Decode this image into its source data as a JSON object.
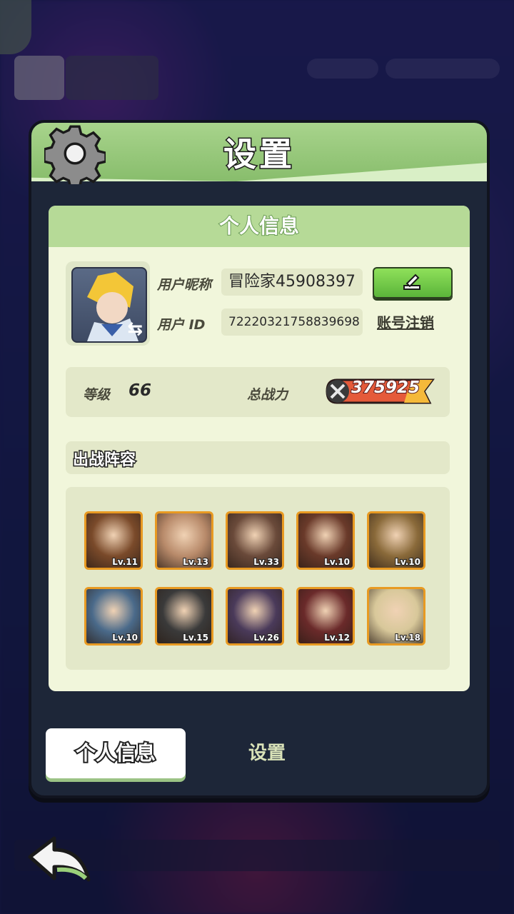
{
  "panel": {
    "title": "设置",
    "card_title": "个人信息",
    "profile": {
      "nickname_label": "用户昵称",
      "nickname": "冒险家45908397",
      "id_label": "用户 ID",
      "user_id": "72220321758839698",
      "delete_account": "账号注销"
    },
    "stats": {
      "level_label": "等级",
      "level": "66",
      "power_label": "总战力",
      "power": "375925"
    },
    "lineup": {
      "title": "出战阵容",
      "heroes": [
        {
          "level": "Lv.11",
          "color": "#7a4a2a"
        },
        {
          "level": "Lv.13",
          "color": "#b88a6a"
        },
        {
          "level": "Lv.33",
          "color": "#6a4a3a"
        },
        {
          "level": "Lv.10",
          "color": "#6a3a2a"
        },
        {
          "level": "Lv.10",
          "color": "#8a6a3a"
        },
        {
          "level": "Lv.10",
          "color": "#4a6a8a"
        },
        {
          "level": "Lv.15",
          "color": "#3a3a3a"
        },
        {
          "level": "Lv.26",
          "color": "#4a3a5a"
        },
        {
          "level": "Lv.12",
          "color": "#6a2a2a"
        },
        {
          "level": "Lv.18",
          "color": "#d8c89a"
        }
      ]
    }
  },
  "tabs": {
    "active": "个人信息",
    "inactive": "设置"
  },
  "colors": {
    "header_green": "#a8d48c",
    "card_bg": "#f1f6db",
    "hero_border": "#e89a22"
  }
}
